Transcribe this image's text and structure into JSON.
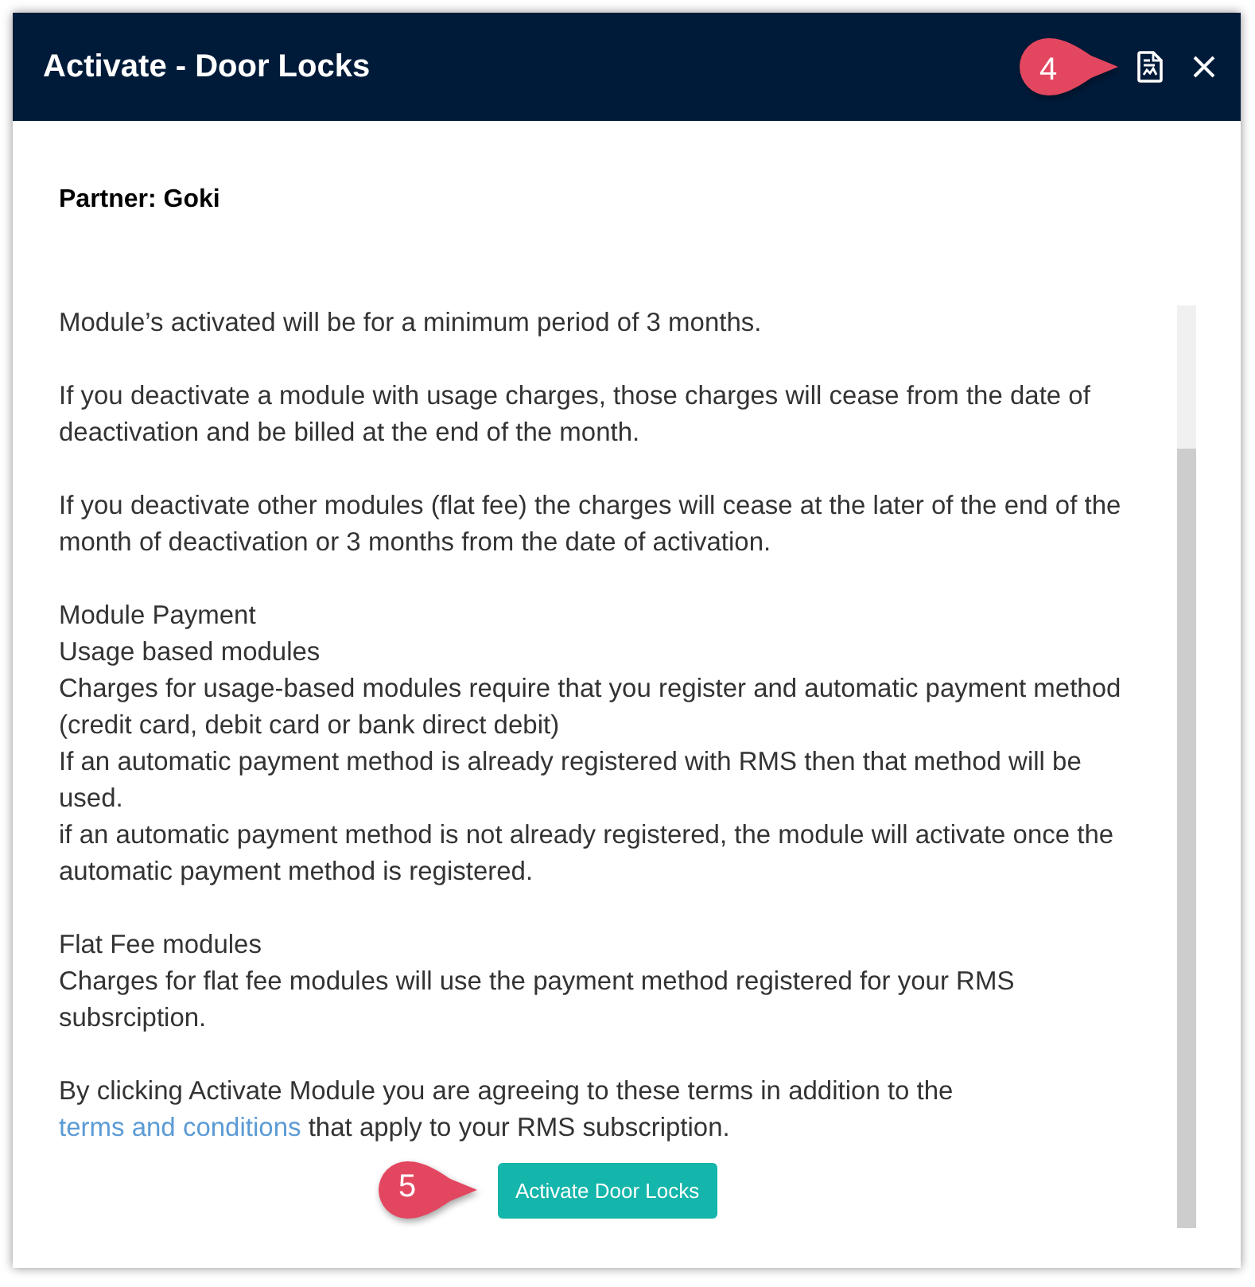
{
  "dialog": {
    "title": "Activate - Door Locks",
    "header_callout": {
      "label": "4"
    },
    "partner": "Partner: Goki"
  },
  "terms": [
    [
      "Module’s activated will be for a minimum period of 3 months."
    ],
    [
      "If you deactivate a module with usage charges, those charges will cease from the date of deactivation and be billed at the end of the month."
    ],
    [
      "If you deactivate other modules (flat fee) the charges will cease at the later of the end of the month of deactivation or 3 months from the date of activation."
    ],
    [
      "Module Payment",
      "Usage based modules",
      "Charges for usage-based modules require that you register and automatic payment method (credit card, debit card or bank direct debit)",
      "If an automatic payment method is already registered with RMS then that method will be used.",
      "if an automatic payment method is not already registered, the module will activate once the automatic payment method is registered."
    ],
    [
      "Flat Fee modules",
      "Charges for flat fee modules will use the payment method registered for your RMS subsrciption."
    ]
  ],
  "agreement": {
    "before": "By clicking Activate Module you are agreeing to these terms in addition to the ",
    "link": "terms and conditions",
    "after": " that apply to your RMS subscription."
  },
  "activate_button": {
    "label": "Activate Door Locks",
    "callout": {
      "label": "5"
    }
  }
}
